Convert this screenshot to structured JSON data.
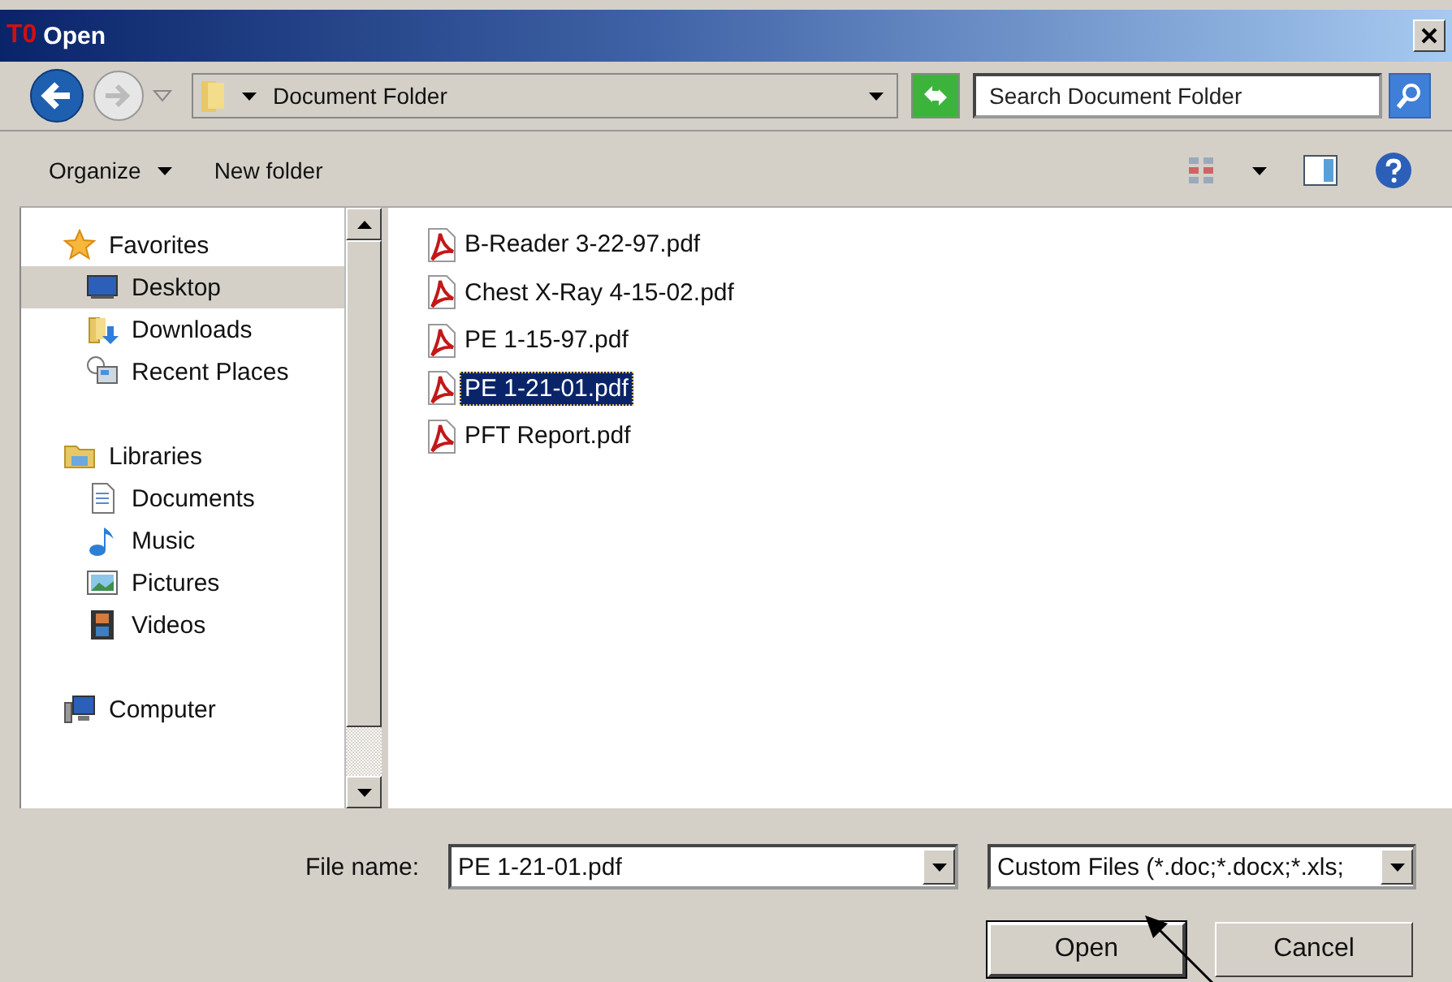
{
  "window": {
    "logo": "T0",
    "title": "Open"
  },
  "address": {
    "path": "Document Folder"
  },
  "search": {
    "placeholder": "Search Document Folder"
  },
  "toolbar": {
    "buttons": [
      {
        "label": "Organize",
        "has_menu": true
      },
      {
        "label": "New folder",
        "has_menu": false
      }
    ]
  },
  "sidebar": {
    "groups": [
      {
        "label": "Favorites",
        "kind": "star",
        "children": [
          {
            "label": "Desktop",
            "kind": "desktop",
            "selected": true
          },
          {
            "label": "Downloads",
            "kind": "downloads",
            "selected": false
          },
          {
            "label": "Recent Places",
            "kind": "recent",
            "selected": false
          }
        ]
      },
      {
        "label": "Libraries",
        "kind": "library",
        "children": [
          {
            "label": "Documents",
            "kind": "documents",
            "selected": false
          },
          {
            "label": "Music",
            "kind": "music",
            "selected": false
          },
          {
            "label": "Pictures",
            "kind": "pictures",
            "selected": false
          },
          {
            "label": "Videos",
            "kind": "videos",
            "selected": false
          }
        ]
      },
      {
        "label": "Computer",
        "kind": "computer"
      }
    ]
  },
  "files": [
    {
      "name": "B-Reader 3-22-97.pdf",
      "selected": false
    },
    {
      "name": "Chest X-Ray 4-15-02.pdf",
      "selected": false
    },
    {
      "name": "PE 1-15-97.pdf",
      "selected": false
    },
    {
      "name": "PE 1-21-01.pdf",
      "selected": true
    },
    {
      "name": "PFT Report.pdf",
      "selected": false
    }
  ],
  "footer": {
    "file_name_label": "File name:",
    "file_name": "PE 1-21-01.pdf",
    "file_type": "Custom Files (*.doc;*.docx;*.xls;",
    "buttons": [
      {
        "label": "Open",
        "default": true
      },
      {
        "label": "Cancel",
        "default": false
      }
    ]
  }
}
